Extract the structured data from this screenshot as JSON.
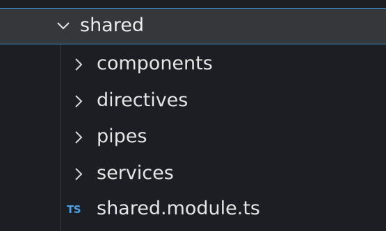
{
  "explorer": {
    "folder": {
      "label": "shared",
      "icon": "chevron-down-icon",
      "expanded": true
    },
    "items": [
      {
        "label": "components",
        "icon": "chevron-right-icon"
      },
      {
        "label": "directives",
        "icon": "chevron-right-icon"
      },
      {
        "label": "pipes",
        "icon": "chevron-right-icon"
      },
      {
        "label": "services",
        "icon": "chevron-right-icon"
      },
      {
        "label": "shared.module.ts",
        "icon": "typescript-file-icon",
        "badge": "TS"
      }
    ]
  },
  "colors": {
    "background": "#1d1e23",
    "selected_background": "#36373a",
    "focus_border": "#3d8fd1",
    "ts_badge": "#4aa3e8",
    "text": "#e6e6e6"
  }
}
